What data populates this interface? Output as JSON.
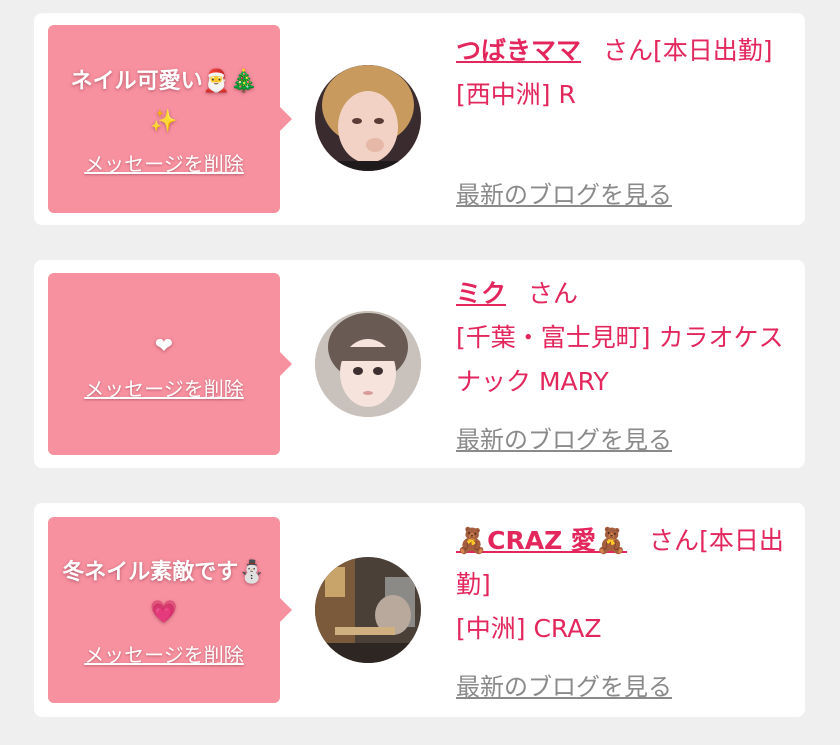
{
  "cards": [
    {
      "message": "ネイル可愛い🎅🎄✨",
      "delete_label": "メッセージを削除",
      "name": "つばきママ",
      "suffix": "さん",
      "attendance": "[本日出勤]",
      "shop": "[西中洲] R",
      "blog_label": "最新のブログを見る"
    },
    {
      "message": "❤",
      "delete_label": "メッセージを削除",
      "name": "ミク",
      "suffix": "さん",
      "attendance": "",
      "shop": "[千葉・富士見町] カラオケスナック MARY",
      "blog_label": "最新のブログを見る"
    },
    {
      "message": "冬ネイル素敵です⛄💗",
      "delete_label": "メッセージを削除",
      "name": "🧸CRAZ 愛🧸",
      "suffix": "さん",
      "attendance": "[本日出勤]",
      "shop": "[中洲] CRAZ",
      "blog_label": "最新のブログを見る"
    }
  ],
  "colors": {
    "page_background": "#efefef",
    "bubble": "#f7909f",
    "accent_text": "#e3265c",
    "link_gray": "#8a8a8a"
  }
}
